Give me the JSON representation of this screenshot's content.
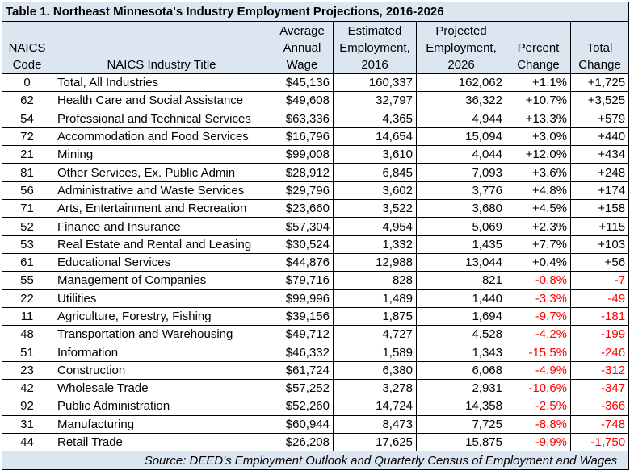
{
  "table": {
    "title": "Table 1.  Northeast Minnesota's Industry Employment Projections, 2016-2026",
    "headers": [
      [
        "NAICS",
        "Code"
      ],
      [
        "NAICS Industry Title"
      ],
      [
        "Average",
        "Annual",
        "Wage"
      ],
      [
        "Estimated",
        "Employment,",
        "2016"
      ],
      [
        "Projected",
        "Employment,",
        "2026"
      ],
      [
        "Percent",
        "Change"
      ],
      [
        "Total",
        "Change"
      ]
    ],
    "rows": [
      [
        "0",
        "Total, All Industries",
        "$45,136",
        "160,337",
        "162,062",
        "+1.1%",
        "+1,725"
      ],
      [
        "62",
        "Health Care and Social Assistance",
        "$49,608",
        "32,797",
        "36,322",
        "+10.7%",
        "+3,525"
      ],
      [
        "54",
        "Professional and Technical Services",
        "$63,336",
        "4,365",
        "4,944",
        "+13.3%",
        "+579"
      ],
      [
        "72",
        "Accommodation and Food Services",
        "$16,796",
        "14,654",
        "15,094",
        "+3.0%",
        "+440"
      ],
      [
        "21",
        "Mining",
        "$99,008",
        "3,610",
        "4,044",
        "+12.0%",
        "+434"
      ],
      [
        "81",
        "Other Services, Ex. Public Admin",
        "$28,912",
        "6,845",
        "7,093",
        "+3.6%",
        "+248"
      ],
      [
        "56",
        "Administrative and Waste Services",
        "$29,796",
        "3,602",
        "3,776",
        "+4.8%",
        "+174"
      ],
      [
        "71",
        "Arts, Entertainment and Recreation",
        "$23,660",
        "3,522",
        "3,680",
        "+4.5%",
        "+158"
      ],
      [
        "52",
        "Finance and Insurance",
        "$57,304",
        "4,954",
        "5,069",
        "+2.3%",
        "+115"
      ],
      [
        "53",
        "Real Estate and Rental and Leasing",
        "$30,524",
        "1,332",
        "1,435",
        "+7.7%",
        "+103"
      ],
      [
        "61",
        "Educational Services",
        "$44,876",
        "12,988",
        "13,044",
        "+0.4%",
        "+56"
      ],
      [
        "55",
        "Management of Companies",
        "$79,716",
        "828",
        "821",
        "-0.8%",
        "-7"
      ],
      [
        "22",
        "Utilities",
        "$99,996",
        "1,489",
        "1,440",
        "-3.3%",
        "-49"
      ],
      [
        "11",
        "Agriculture, Forestry, Fishing",
        "$39,156",
        "1,875",
        "1,694",
        "-9.7%",
        "-181"
      ],
      [
        "48",
        "Transportation and Warehousing",
        "$49,712",
        "4,727",
        "4,528",
        "-4.2%",
        "-199"
      ],
      [
        "51",
        "Information",
        "$46,332",
        "1,589",
        "1,343",
        "-15.5%",
        "-246"
      ],
      [
        "23",
        "Construction",
        "$61,724",
        "6,380",
        "6,068",
        "-4.9%",
        "-312"
      ],
      [
        "42",
        "Wholesale Trade",
        "$57,252",
        "3,278",
        "2,931",
        "-10.6%",
        "-347"
      ],
      [
        "92",
        "Public Administration",
        "$52,260",
        "14,724",
        "14,358",
        "-2.5%",
        "-366"
      ],
      [
        "31",
        "Manufacturing",
        "$60,944",
        "8,473",
        "7,725",
        "-8.8%",
        "-748"
      ],
      [
        "44",
        "Retail Trade",
        "$26,208",
        "17,625",
        "15,875",
        "-9.9%",
        "-1,750"
      ]
    ],
    "source": "Source:  DEED's Employment Outlook and Quarterly Census of Employment and Wages"
  },
  "colors": {
    "header_bg": "#dce6f1",
    "negative_text": "#ff0000",
    "border": "#000000"
  }
}
